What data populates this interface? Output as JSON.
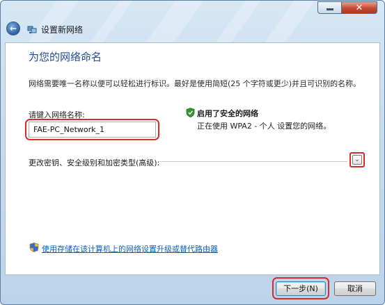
{
  "window": {
    "title": "设置新网络",
    "controls": {
      "minimize_icon": "minimize-icon",
      "close_glyph": "✕"
    }
  },
  "content": {
    "heading": "为您的网络命名",
    "description": "网络需要唯一名称以便可以轻松进行标识。最好是使用简短(25 个字符或更少)并且可识别的名称。",
    "name_label": "请键入网络名称:",
    "name_value": "FAE-PC_Network_1",
    "security": {
      "title": "启用了安全的网络",
      "description": "正在使用 WPA2 - 个人 设置您的网络。",
      "icon": "shield-check-icon"
    },
    "advanced_label": "更改密钥、安全级别和加密类型(高级):",
    "expand_glyph": "⌄",
    "link_text": "使用存储在该计算机上的网络设置升级或替代路由器",
    "link_icon": "uac-shield-icon"
  },
  "buttons": {
    "next_label": "下一步(N)",
    "cancel_label": "取消"
  },
  "colors": {
    "heading": "#1f4b99",
    "link": "#0b5fb5",
    "highlight": "#d42b2b",
    "shield_green": "#2e9a2e"
  }
}
